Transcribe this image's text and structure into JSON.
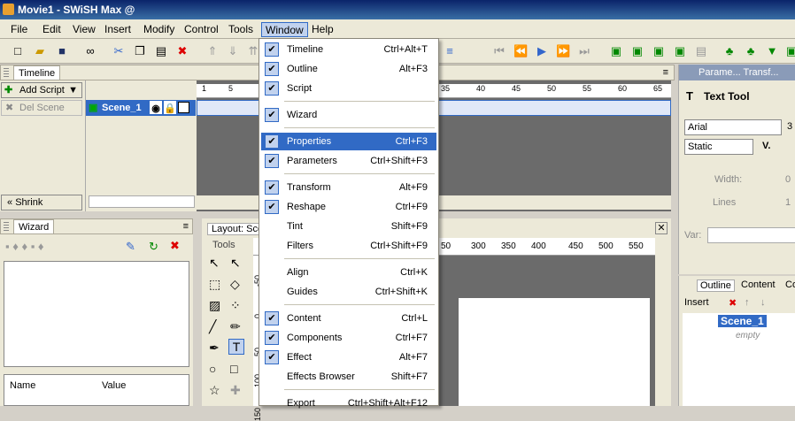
{
  "title": "Movie1 - SWiSH Max @",
  "menubar": [
    "File",
    "Edit",
    "View",
    "Insert",
    "Modify",
    "Control",
    "Tools",
    "Window",
    "Help"
  ],
  "timeline": {
    "tab": "Timeline",
    "add_script": "Add Script",
    "del_scene": "Del Scene",
    "scene": "Scene_1",
    "shrink": "Shrink",
    "ticks": [
      "1",
      "5",
      "35",
      "40",
      "45",
      "50",
      "55",
      "60",
      "65"
    ]
  },
  "wizard": {
    "tab": "Wizard",
    "col_name": "Name",
    "col_value": "Value"
  },
  "layout": {
    "tab": "Layout: Sce",
    "tools": "Tools",
    "ruler_top": [
      "50",
      "300",
      "350",
      "400",
      "450",
      "500",
      "550"
    ],
    "ruler_left": [
      "-50",
      "0",
      "50",
      "100",
      "150"
    ]
  },
  "properties": {
    "tabs": "Parame... Transf...",
    "tool": "Text Tool",
    "font": "Arial",
    "size": "3",
    "type": "Static",
    "width_label": "Width:",
    "width_val": "0",
    "lines_label": "Lines",
    "lines_val": "1",
    "var_label": "Var:"
  },
  "outline": {
    "tabs": [
      "Outline",
      "Content",
      "Co"
    ],
    "insert": "Insert",
    "scene": "Scene_1",
    "empty": "empty"
  },
  "window_menu": [
    {
      "label": "Timeline",
      "shortcut": "Ctrl+Alt+T",
      "checked": true
    },
    {
      "label": "Outline",
      "shortcut": "Alt+F3",
      "checked": true
    },
    {
      "label": "Script",
      "shortcut": "",
      "checked": true
    },
    {
      "label": "Wizard",
      "shortcut": "",
      "checked": true
    },
    {
      "label": "Properties",
      "shortcut": "Ctrl+F3",
      "checked": true
    },
    {
      "label": "Parameters",
      "shortcut": "Ctrl+Shift+F3",
      "checked": true
    },
    {
      "label": "Transform",
      "shortcut": "Alt+F9",
      "checked": true
    },
    {
      "label": "Reshape",
      "shortcut": "Ctrl+F9",
      "checked": true
    },
    {
      "label": "Tint",
      "shortcut": "Shift+F9",
      "checked": false
    },
    {
      "label": "Filters",
      "shortcut": "Ctrl+Shift+F9",
      "checked": false
    },
    {
      "label": "Align",
      "shortcut": "Ctrl+K",
      "checked": false
    },
    {
      "label": "Guides",
      "shortcut": "Ctrl+Shift+K",
      "checked": false
    },
    {
      "label": "Content",
      "shortcut": "Ctrl+L",
      "checked": true
    },
    {
      "label": "Components",
      "shortcut": "Ctrl+F7",
      "checked": true
    },
    {
      "label": "Effect",
      "shortcut": "Alt+F7",
      "checked": true
    },
    {
      "label": "Effects Browser",
      "shortcut": "Shift+F7",
      "checked": false
    },
    {
      "label": "Export",
      "shortcut": "Ctrl+Shift+Alt+F12",
      "checked": false
    }
  ],
  "colors": {
    "highlight": "#316ac5",
    "accent": "#c1d2ee"
  }
}
